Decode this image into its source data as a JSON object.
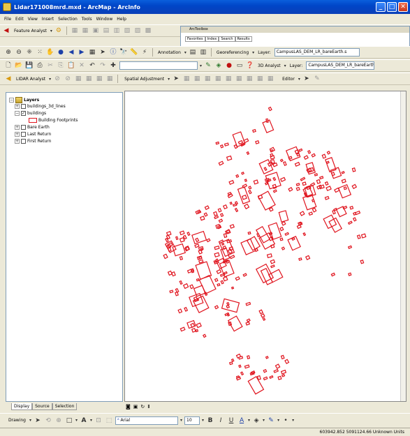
{
  "window": {
    "title": "Lidar171008mrd.mxd - ArcMap - ArcInfo",
    "controls": [
      "_",
      "□",
      "✕"
    ]
  },
  "menu": [
    "File",
    "Edit",
    "View",
    "Insert",
    "Selection",
    "Tools",
    "Window",
    "Help"
  ],
  "toolbar1": {
    "feature_analyst": "Feature Analyst",
    "arctoolbox_title": "ArcToolbox",
    "arctoolbox_tabs": [
      "Favorites",
      "Index",
      "Search",
      "Results"
    ]
  },
  "toolbar2": {
    "annotation": "Annotation",
    "georeferencing": "Georeferencing",
    "layer_label": "Layer:",
    "layer_value": "CampusLAS_DEM_LR_bareEarth.s"
  },
  "toolbar3": {
    "analyst_3d": "3D Analyst",
    "layer_label": "Layer:",
    "layer_value": "CampusLAS_DEM_LR_bareEarth"
  },
  "toolbar4": {
    "lidar_analyst": "LIDAR Analyst",
    "spatial_adjustment": "Spatial Adjustment",
    "editor": "Editor"
  },
  "toc": {
    "root": "Layers",
    "items": [
      {
        "label": "buildings_3d_lines",
        "checked": false,
        "expanded": false
      },
      {
        "label": "buildings",
        "checked": true,
        "expanded": true
      },
      {
        "label": "Building Footprints",
        "symbol": true
      },
      {
        "label": "Bare Earth",
        "checked": false,
        "expanded": false
      },
      {
        "label": "Last Return",
        "checked": false,
        "expanded": false
      },
      {
        "label": "First Return",
        "checked": false,
        "expanded": false
      }
    ],
    "tabs": [
      "Display",
      "Source",
      "Selection"
    ]
  },
  "map": {
    "feature_color": "#e0141e",
    "nav_icons": [
      "globe-icon",
      "refresh-icon",
      "pause-icon",
      "refresh-icon"
    ]
  },
  "drawbar": {
    "drawing": "Drawing",
    "font": "Arial",
    "size": "10",
    "bold": "B",
    "italic": "I",
    "underline": "U"
  },
  "status": {
    "coordinates": "603942.852  5091124.66 Unknown Units"
  }
}
